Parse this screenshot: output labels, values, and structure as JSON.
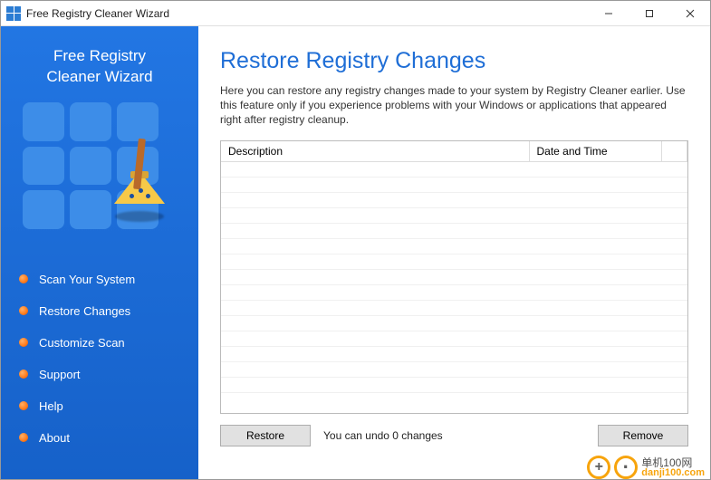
{
  "window": {
    "title": "Free Registry Cleaner Wizard"
  },
  "sidebar": {
    "title_line1": "Free Registry",
    "title_line2": "Cleaner Wizard",
    "nav": [
      {
        "label": "Scan Your System"
      },
      {
        "label": "Restore Changes"
      },
      {
        "label": "Customize Scan"
      },
      {
        "label": "Support"
      },
      {
        "label": "Help"
      },
      {
        "label": "About"
      }
    ]
  },
  "main": {
    "heading": "Restore Registry Changes",
    "intro": "Here you can restore any registry changes made to your system by Registry Cleaner earlier. Use this feature only if you experience problems with your Windows or applications that appeared right after registry cleanup.",
    "columns": {
      "description": "Description",
      "datetime": "Date and Time"
    },
    "rows": [],
    "buttons": {
      "restore": "Restore",
      "remove": "Remove"
    },
    "status": "You can undo 0 changes"
  },
  "watermark": {
    "cn": "单机100网",
    "domain": "danji100.com"
  }
}
